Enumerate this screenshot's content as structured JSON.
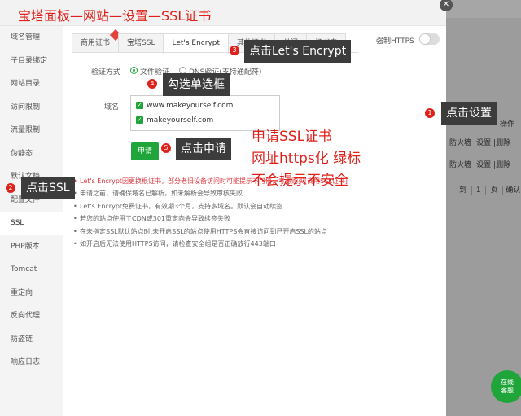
{
  "annotation_title": "宝塔面板—网站—设置—SSL证书",
  "sidebar": {
    "items": [
      {
        "label": "域名管理"
      },
      {
        "label": "子目录绑定"
      },
      {
        "label": "网站目录"
      },
      {
        "label": "访问限制"
      },
      {
        "label": "流量限制"
      },
      {
        "label": "伪静态"
      },
      {
        "label": "默认文档"
      },
      {
        "label": "配置文件"
      },
      {
        "label": "SSL",
        "active": true
      },
      {
        "label": "PHP版本"
      },
      {
        "label": "Tomcat"
      },
      {
        "label": "重定向"
      },
      {
        "label": "反向代理"
      },
      {
        "label": "防盗链"
      },
      {
        "label": "响应日志"
      }
    ]
  },
  "tabs": [
    {
      "label": "商用证书"
    },
    {
      "label": "宝塔SSL"
    },
    {
      "label": "Let's Encrypt",
      "active": true
    },
    {
      "label": "其他证书"
    },
    {
      "label": "关闭"
    },
    {
      "label": "证书夹"
    }
  ],
  "force_https": {
    "label": "强制HTTPS",
    "enabled": false
  },
  "form": {
    "verify_label": "验证方式",
    "verify_options": [
      {
        "label": "文件验证",
        "selected": true
      },
      {
        "label": "DNS验证(支持通配符)",
        "selected": false
      }
    ],
    "domain_label": "域名",
    "domains": [
      {
        "name": "www.makeyourself.com",
        "checked": true
      },
      {
        "name": "makeyourself.com",
        "checked": true
      }
    ],
    "apply_button": "申请"
  },
  "notes": [
    "Let's Encrypt因更换根证书，部分老旧设备访问时可能提示不可信，考虑购买[商用SSL证书]",
    "申请之前，请确保域名已解析，如未解析会导致审核失败",
    "Let's Encrypt免费证书，有效期3个月，支持多域名。默认会自动续签",
    "若您的站点使用了CDN或301重定向会导致续签失败",
    "在未指定SSL默认站点时,未开启SSL的站点使用HTTPS会直接访问到已开启SSL的站点",
    "如开启后无法使用HTTPS访问，请检查安全组是否正确放行443端口"
  ],
  "background": {
    "header_action": "操作",
    "row_links": [
      "防火墙",
      "设置",
      "删除"
    ],
    "pager": {
      "goto": "到",
      "page": "1",
      "unit": "页",
      "confirm": "确认"
    }
  },
  "annotations": {
    "step1": {
      "num": "1",
      "text": "点击设置"
    },
    "step2": {
      "num": "2",
      "text": "点击SSL"
    },
    "step3": {
      "num": "3",
      "text": "点击Let's Encrypt"
    },
    "step4": {
      "num": "4",
      "text": "勾选单选框"
    },
    "step5": {
      "num": "5",
      "text": "点击申请"
    },
    "note_lines": [
      "申请SSL证书",
      "网址https化 绿标",
      "不会提示不安全"
    ]
  },
  "chat_widget": {
    "line1": "在线",
    "line2": "客服"
  },
  "colors": {
    "accent": "#20a53a",
    "annotation_red": "#e0211b",
    "warning_red": "#d9363e"
  }
}
